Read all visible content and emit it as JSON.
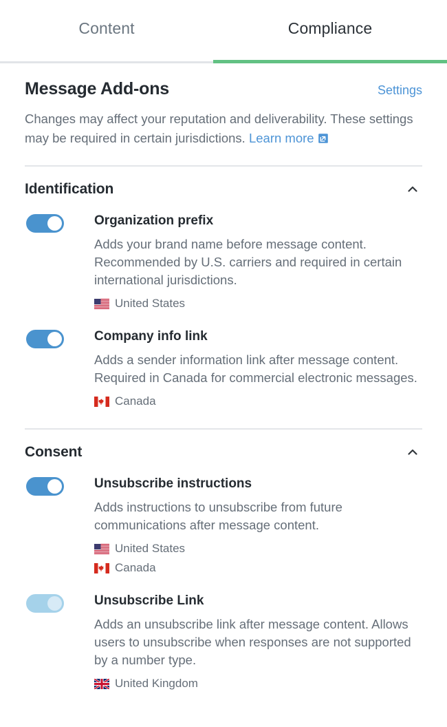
{
  "tabs": [
    {
      "label": "Content",
      "active": false
    },
    {
      "label": "Compliance",
      "active": true
    }
  ],
  "panel": {
    "title": "Message Add-ons",
    "settings_label": "Settings",
    "description": "Changes may affect your reputation and deliverability. These settings may be required in certain jurisdictions.",
    "learn_more_label": "Learn more"
  },
  "sections": [
    {
      "title": "Identification",
      "collapse_icon": "chevron-up-icon",
      "items": [
        {
          "title": "Organization prefix",
          "description": "Adds your brand name before message content. Recommended by U.S. carriers and required in certain international jurisdictions.",
          "enabled": true,
          "dimmed": false,
          "regions": [
            {
              "flag": "flag-us",
              "label": "United States"
            }
          ]
        },
        {
          "title": "Company info link",
          "description": "Adds a sender information link after message content. Required in Canada for commercial electronic messages.",
          "enabled": true,
          "dimmed": false,
          "regions": [
            {
              "flag": "flag-ca",
              "label": "Canada"
            }
          ]
        }
      ]
    },
    {
      "title": "Consent",
      "collapse_icon": "chevron-up-icon",
      "items": [
        {
          "title": "Unsubscribe instructions",
          "description": "Adds instructions to unsubscribe from future communications after message content.",
          "enabled": true,
          "dimmed": false,
          "regions": [
            {
              "flag": "flag-us",
              "label": "United States"
            },
            {
              "flag": "flag-ca",
              "label": "Canada"
            }
          ]
        },
        {
          "title": "Unsubscribe Link",
          "description": "Adds an unsubscribe link after message content. Allows users to unsubscribe when responses are not supported by a number type.",
          "enabled": true,
          "dimmed": true,
          "regions": [
            {
              "flag": "flag-gb",
              "label": "United Kingdom"
            }
          ]
        }
      ]
    }
  ],
  "colors": {
    "accent_green": "#62c183",
    "link_blue": "#4d94d6",
    "toggle_on": "#4a93ce",
    "toggle_dim": "#a5d2ea",
    "text_dark": "#252b31",
    "text_muted": "#656e78",
    "divider": "#e3e6e9"
  }
}
